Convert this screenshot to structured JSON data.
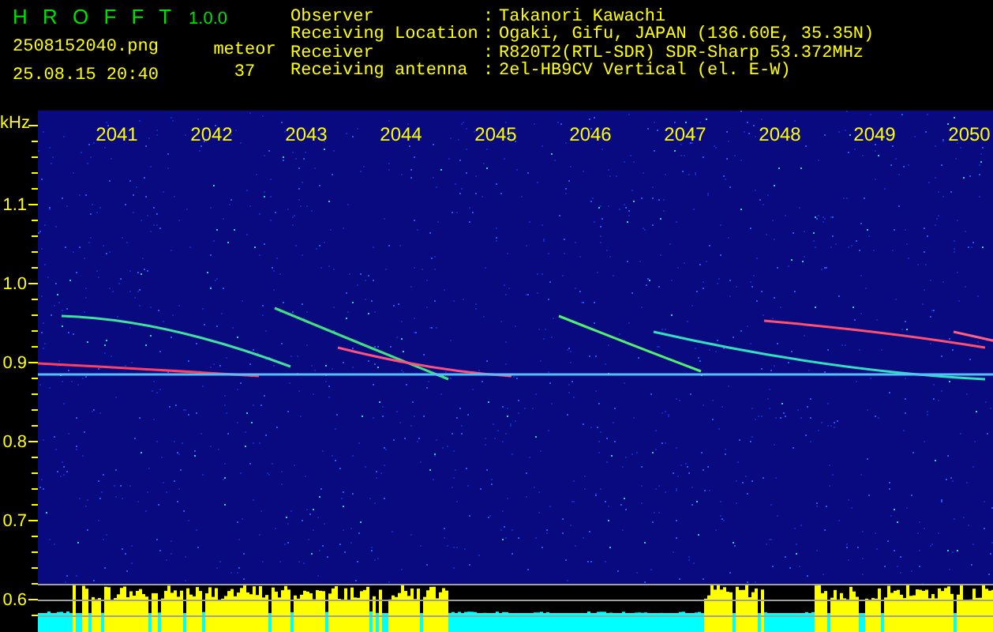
{
  "app": {
    "name": "H R O F F T",
    "version": "1.0.0"
  },
  "file": "2508152040.png",
  "datetime": "25.08.15 20:40",
  "count": {
    "label": "meteor",
    "value": "37"
  },
  "separator": ":",
  "info": [
    {
      "label": "Observer",
      "value": "Takanori Kawachi"
    },
    {
      "label": "Receiving Location",
      "value": "Ogaki, Gifu, JAPAN (136.60E, 35.35N)"
    },
    {
      "label": "Receiver",
      "value": "R820T2(RTL-SDR) SDR-Sharp 53.372MHz"
    },
    {
      "label": "Receiving antenna",
      "value": "2el-HB9CV Vertical (el. E-W)"
    }
  ],
  "spectrogram": {
    "y_unit": "kHz",
    "y_labels": [
      "1.1",
      "1.0",
      "0.9",
      "0.8",
      "0.7",
      "0.6"
    ],
    "x_labels": [
      "2041",
      "2042",
      "2043",
      "2044",
      "2045",
      "2046",
      "2047",
      "2048",
      "2049",
      "2050"
    ]
  }
}
